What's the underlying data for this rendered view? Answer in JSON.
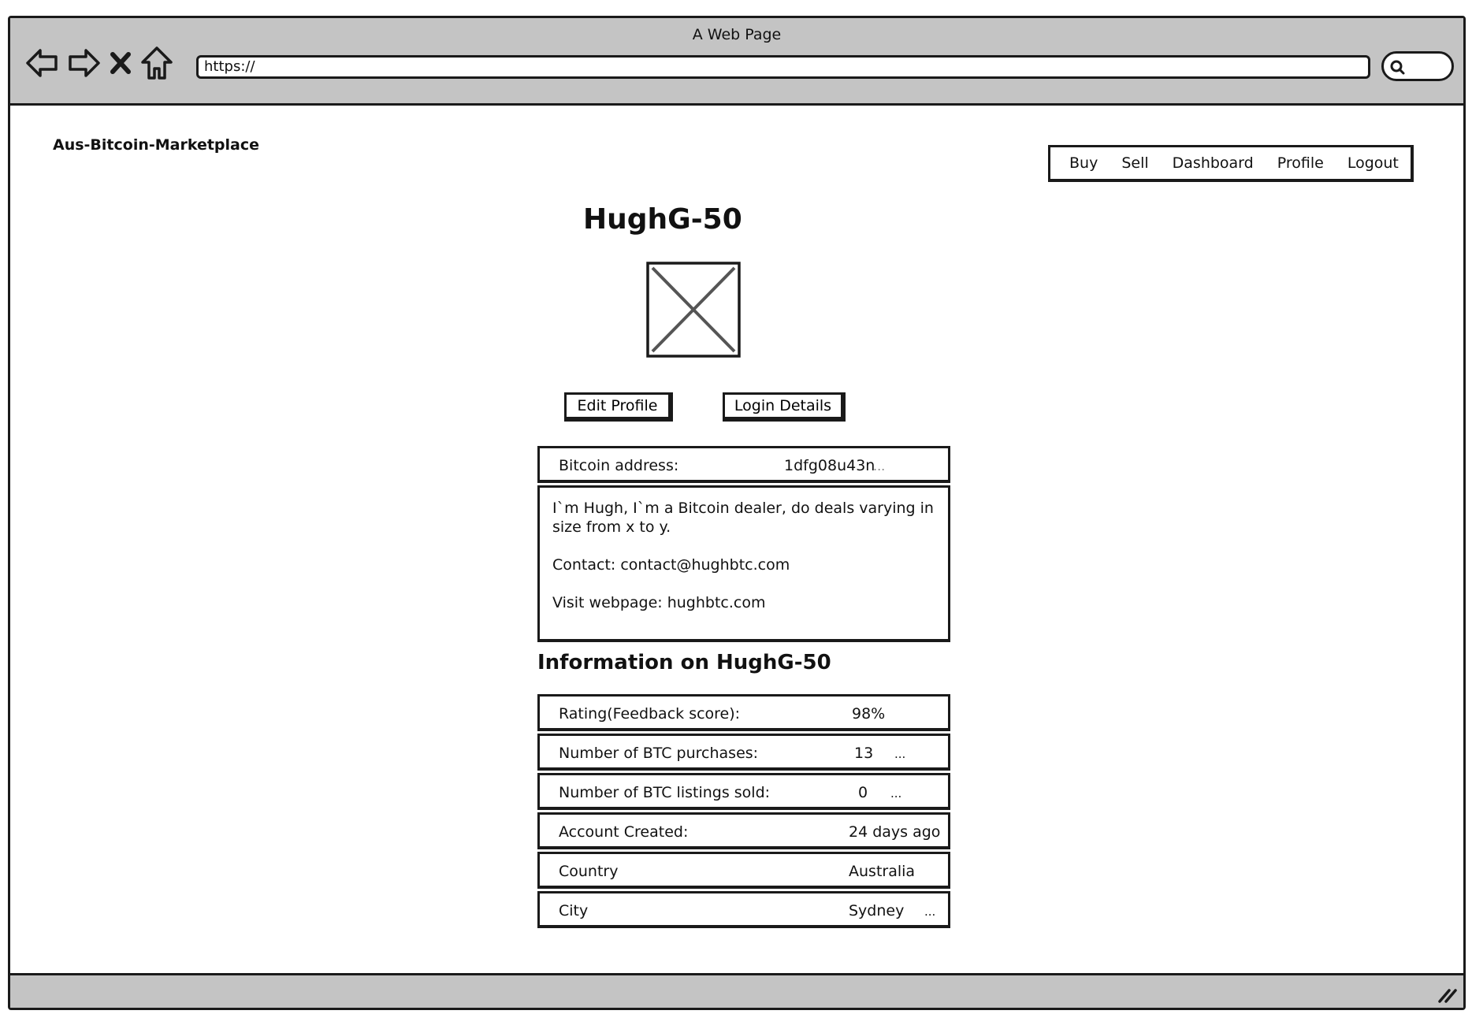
{
  "window": {
    "title": "A Web Page",
    "url": "https://"
  },
  "header": {
    "brand": "Aus-Bitcoin-Marketplace",
    "nav": [
      "Buy",
      "Sell",
      "Dashboard",
      "Profile",
      "Logout"
    ]
  },
  "profile": {
    "username": "HughG-50",
    "buttons": {
      "edit": "Edit Profile",
      "login": "Login Details"
    },
    "bitcoin": {
      "label": "Bitcoin address:",
      "value": "1dfg08u43n",
      "ellipsis": "..."
    },
    "bio": {
      "intro": "I`m Hugh, I`m a Bitcoin dealer, do deals varying in size from x to y.",
      "contact": "Contact: contact@hughbtc.com",
      "webpage": "Visit webpage: hughbtc.com"
    }
  },
  "info": {
    "heading": "Information on HughG-50",
    "rows": [
      {
        "label": "Rating(Feedback score):",
        "value": "98%",
        "more": ""
      },
      {
        "label": "Number of BTC purchases:",
        "value": "13",
        "more": "..."
      },
      {
        "label": "Number of BTC listings sold:",
        "value": "0",
        "more": "..."
      },
      {
        "label": "Account Created:",
        "value": "24 days ago",
        "more": ""
      },
      {
        "label": "Country",
        "value": "Australia",
        "more": ""
      },
      {
        "label": "City",
        "value": "Sydney",
        "more": "..."
      }
    ]
  }
}
